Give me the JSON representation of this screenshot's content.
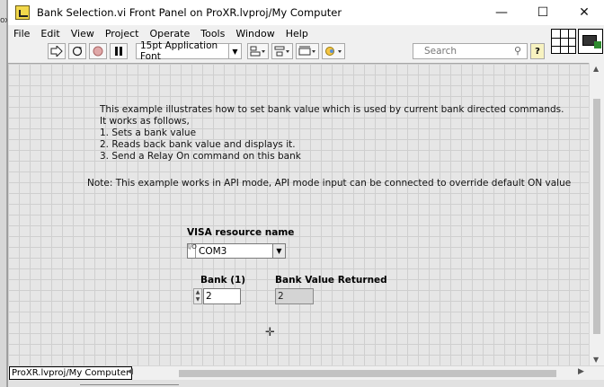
{
  "window": {
    "title": "Bank Selection.vi Front Panel on ProXR.lvproj/My Computer",
    "controls": {
      "minimize": "—",
      "maximize": "☐",
      "close": "✕"
    },
    "left_fragment": "ox"
  },
  "menubar": {
    "items": [
      {
        "id": "file",
        "label": "File"
      },
      {
        "id": "edit",
        "label": "Edit"
      },
      {
        "id": "view",
        "label": "View"
      },
      {
        "id": "project",
        "label": "Project"
      },
      {
        "id": "operate",
        "label": "Operate"
      },
      {
        "id": "tools",
        "label": "Tools"
      },
      {
        "id": "window",
        "label": "Window"
      },
      {
        "id": "help",
        "label": "Help"
      }
    ]
  },
  "toolbar": {
    "run_icon": "run-arrow-icon",
    "run_continuous_icon": "run-continuously-icon",
    "abort_icon": "abort-execution-icon",
    "pause_icon": "pause-icon",
    "font": "15pt Application Font",
    "align_icon": "align-objects-icon",
    "distribute_icon": "distribute-objects-icon",
    "resize_icon": "resize-objects-icon",
    "reorder_icon": "reorder-icon",
    "search_placeholder": "Search",
    "help_label": "?"
  },
  "panel": {
    "description_lines": [
      "This example illustrates how to set bank value which is used by current bank directed commands.",
      "It works as follows,",
      "1. Sets a bank value",
      "2. Reads back bank value and displays it.",
      "3. Send a Relay On command on this bank"
    ],
    "note": "Note: This example works in API mode, API mode input can be connected to override default ON value",
    "visa": {
      "label": "VISA resource name",
      "value": "COM3",
      "io_prefix": "I/O"
    },
    "bank": {
      "label": "Bank (1)",
      "value": "2"
    },
    "returned": {
      "label": "Bank Value Returned",
      "value": "2"
    }
  },
  "statusbar": {
    "context": "ProXR.lvproj/My Computer"
  }
}
